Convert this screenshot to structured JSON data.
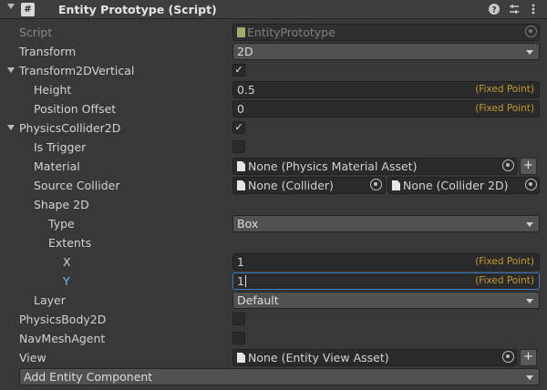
{
  "header": {
    "title": "Entity Prototype (Script)",
    "script_icon_glyph": "#"
  },
  "rows": {
    "script": {
      "label": "Script",
      "value": "EntityPrototype"
    },
    "transform": {
      "label": "Transform",
      "value": "2D"
    },
    "transform2d_vertical": {
      "label": "Transform2DVertical",
      "checked": true
    },
    "height": {
      "label": "Height",
      "value": "0.5",
      "suffix": "(Fixed Point)"
    },
    "position_offset": {
      "label": "Position Offset",
      "value": "0",
      "suffix": "(Fixed Point)"
    },
    "physics_collider_2d": {
      "label": "PhysicsCollider2D",
      "checked": true
    },
    "is_trigger": {
      "label": "Is Trigger",
      "checked": false
    },
    "material": {
      "label": "Material",
      "value": "None (Physics Material Asset)"
    },
    "source_collider": {
      "label": "Source Collider",
      "value1": "None (Collider)",
      "value2": "None (Collider 2D)"
    },
    "shape_2d": {
      "label": "Shape 2D"
    },
    "type": {
      "label": "Type",
      "value": "Box"
    },
    "extents": {
      "label": "Extents"
    },
    "x": {
      "label": "X",
      "value": "1",
      "suffix": "(Fixed Point)"
    },
    "y": {
      "label": "Y",
      "value": "1",
      "suffix": "(Fixed Point)"
    },
    "layer": {
      "label": "Layer",
      "value": "Default"
    },
    "physics_body_2d": {
      "label": "PhysicsBody2D",
      "checked": false
    },
    "nav_mesh_agent": {
      "label": "NavMeshAgent",
      "checked": false
    },
    "view": {
      "label": "View",
      "value": "None (Entity View Asset)"
    }
  },
  "add_component": {
    "label": "Add Entity Component"
  },
  "icons": {
    "help": "help-icon",
    "presets": "presets-icon",
    "more": "kebab-menu-icon",
    "checkmark": "✓",
    "plus": "+"
  },
  "colors": {
    "background": "#383838",
    "field": "#2a2a2a",
    "dropdown": "#515151",
    "fixed_point_suffix": "#c39a2c",
    "focus": "#3a79bb"
  }
}
